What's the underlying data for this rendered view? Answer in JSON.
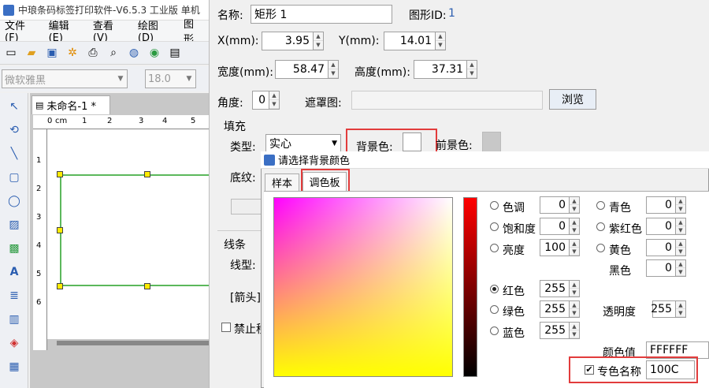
{
  "app": {
    "title": "中琅条码标签打印软件-V6.5.3 工业版 单机"
  },
  "menu": [
    "文件(F)",
    "编辑(E)",
    "查看(V)",
    "绘图(D)",
    "图形"
  ],
  "font": {
    "family": "微软雅黑",
    "size": "18.0"
  },
  "document": {
    "tab_label": "未命名-1 *",
    "ruler_top": [
      "0",
      "cm",
      "1",
      "2",
      "3",
      "4",
      "5"
    ],
    "ruler_left": [
      "1",
      "2",
      "3",
      "4",
      "5",
      "6"
    ]
  },
  "props": {
    "name_label": "名称:",
    "name_value": "矩形 1",
    "shape_id_label": "图形ID:",
    "shape_id_value": "1",
    "x_label": "X(mm):",
    "x_value": "3.95",
    "y_label": "Y(mm):",
    "y_value": "14.01",
    "width_label": "宽度(mm):",
    "width_value": "58.47",
    "height_label": "高度(mm):",
    "height_value": "37.31",
    "angle_label": "角度:",
    "angle_value": "0",
    "mask_label": "遮罩图:",
    "browse_label": "浏览",
    "fill_group": "填充",
    "fill_type_label": "类型:",
    "fill_type_value": "实心",
    "bg_color_label": "背景色:",
    "fg_color_label": "前景色:",
    "texture_label": "底纹:",
    "line_group": "线条",
    "line_type_label": "线型:",
    "arrow_label": "[箭头]",
    "disable_label": "禁止移"
  },
  "dialog": {
    "title": "请选择背景颜色",
    "tabs": [
      "样本",
      "调色板"
    ],
    "active_tab": "调色板",
    "hue_label": "色调",
    "hue": "0",
    "sat_label": "饱和度",
    "sat": "0",
    "bright_label": "亮度",
    "bright": "100",
    "red_label": "红色",
    "red": "255",
    "green_label": "绿色",
    "green": "255",
    "blue_label": "蓝色",
    "blue": "255",
    "cyan_label": "青色",
    "cyan": "0",
    "magenta_label": "紫红色",
    "magenta": "0",
    "yellow_label": "黄色",
    "yellow": "0",
    "black_label": "黑色",
    "black": "0",
    "alpha_label": "透明度",
    "alpha": "255",
    "color_value_label": "颜色值",
    "color_value": "FFFFFF",
    "spot_label": "专色名称",
    "spot_value": "100C"
  },
  "colors": {
    "accent": "#e23c3c",
    "selection": "#5cb85c",
    "handle": "#ffeb00"
  }
}
